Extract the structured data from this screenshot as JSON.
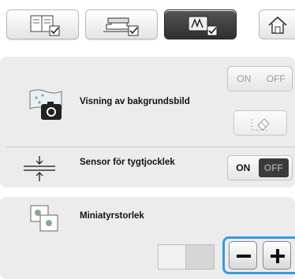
{
  "tabs": [
    {
      "name": "general-settings-tab",
      "icon": "book-check-icon",
      "active": false
    },
    {
      "name": "sewing-settings-tab",
      "icon": "sewing-machine-check-icon",
      "active": false
    },
    {
      "name": "embroidery-settings-tab",
      "icon": "embroidery-frame-check-icon",
      "active": true
    }
  ],
  "home": {
    "icon": "home-icon"
  },
  "settings": {
    "background_image": {
      "label": "Visning av bakgrundsbild",
      "icon": "camera-icon",
      "toggle": {
        "on": "ON",
        "off": "OFF",
        "enabled": false
      },
      "erase_icon": "eraser-icon"
    },
    "fabric_sensor": {
      "label": "Sensor för tygtjocklek",
      "icon": "fabric-thickness-icon",
      "toggle": {
        "on": "ON",
        "off": "OFF",
        "selected": "ON"
      }
    },
    "thumbnail_size": {
      "label": "Miniatyrstorlek",
      "icon": "thumbnail-icon",
      "minus_icon": "minus-icon",
      "plus_icon": "plus-icon"
    }
  },
  "colors": {
    "highlight": "#3a9bdc",
    "panel": "#ececec",
    "active_tab": "#3a3a3a"
  }
}
